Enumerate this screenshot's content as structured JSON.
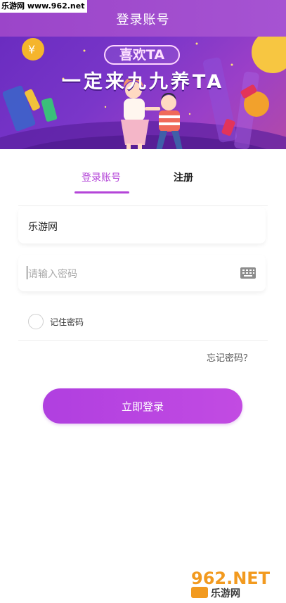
{
  "watermark_top": "乐游网 www.962.net",
  "header": {
    "title": "登录账号"
  },
  "banner": {
    "tag": "喜欢TA",
    "slogan": "一定来九九养TA"
  },
  "tabs": {
    "login": "登录账号",
    "register": "注册"
  },
  "username": {
    "value": "乐游网"
  },
  "password": {
    "placeholder": "请输入密码"
  },
  "remember": {
    "label": "记住密码",
    "checked": false
  },
  "forgot": {
    "label": "忘记密码？"
  },
  "login_button": {
    "label": "立即登录"
  },
  "watermark_bottom": {
    "text": "962.NET",
    "subtext": "乐游网"
  },
  "colors": {
    "accent": "#b445d8",
    "header": "#9b45c9",
    "button": "#b03fe0"
  }
}
